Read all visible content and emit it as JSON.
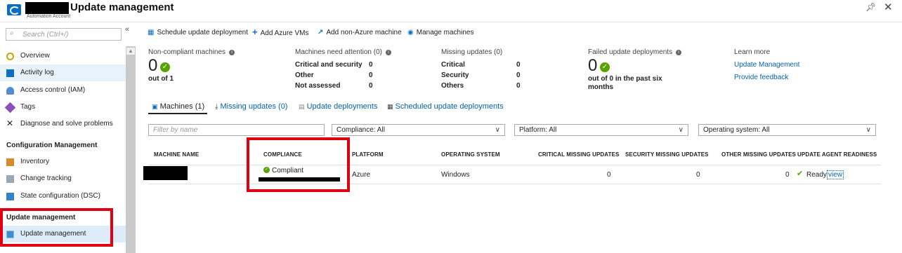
{
  "header": {
    "title": "Update management",
    "subtitle": "Automation Account"
  },
  "sidebar": {
    "search_placeholder": "Search (Ctrl+/)",
    "items_top": [
      {
        "label": "Overview",
        "icon": "overview-icon"
      },
      {
        "label": "Activity log",
        "icon": "activity-log-icon"
      },
      {
        "label": "Access control (IAM)",
        "icon": "access-control-icon"
      },
      {
        "label": "Tags",
        "icon": "tag-icon"
      },
      {
        "label": "Diagnose and solve problems",
        "icon": "wrench-icon"
      }
    ],
    "section_config": "Configuration Management",
    "items_config": [
      {
        "label": "Inventory",
        "icon": "inventory-icon"
      },
      {
        "label": "Change tracking",
        "icon": "change-tracking-icon"
      },
      {
        "label": "State configuration (DSC)",
        "icon": "dsc-icon"
      }
    ],
    "section_update": "Update management",
    "items_update": [
      {
        "label": "Update management",
        "icon": "update-management-icon"
      }
    ]
  },
  "toolbar": {
    "schedule": "Schedule update deployment",
    "add_azure": "Add Azure VMs",
    "add_non_azure": "Add non-Azure machine",
    "manage": "Manage machines"
  },
  "summary": {
    "noncompliant": {
      "label": "Non-compliant machines",
      "value": "0",
      "caption": "out of 1"
    },
    "attention": {
      "label": "Machines need attention (0)",
      "rows": [
        {
          "key": "Critical and security",
          "value": "0"
        },
        {
          "key": "Other",
          "value": "0"
        },
        {
          "key": "Not assessed",
          "value": "0"
        }
      ]
    },
    "missing": {
      "label": "Missing updates (0)",
      "rows": [
        {
          "key": "Critical",
          "value": "0"
        },
        {
          "key": "Security",
          "value": "0"
        },
        {
          "key": "Others",
          "value": "0"
        }
      ]
    },
    "failed": {
      "label": "Failed update deployments",
      "value": "0",
      "caption_line1": "out of 0 in the past six",
      "caption_line2": "months"
    },
    "learn": {
      "label": "Learn more",
      "link1": "Update Management",
      "link2": "Provide feedback"
    }
  },
  "tabs": [
    {
      "label": "Machines (1)",
      "icon": "monitor-icon"
    },
    {
      "label": "Missing updates (0)",
      "icon": "download-icon"
    },
    {
      "label": "Update deployments",
      "icon": "deployments-icon"
    },
    {
      "label": "Scheduled update deployments",
      "icon": "calendar-icon"
    }
  ],
  "filters": {
    "name_placeholder": "Filter by name",
    "compliance": "Compliance: All",
    "platform": "Platform: All",
    "os": "Operating system: All"
  },
  "table": {
    "headers": [
      "MACHINE NAME",
      "COMPLIANCE",
      "PLATFORM",
      "OPERATING SYSTEM",
      "CRITICAL MISSING UPDATES",
      "SECURITY MISSING UPDATES",
      "OTHER MISSING UPDATES",
      "UPDATE AGENT READINESS"
    ],
    "row": {
      "compliance": "Compliant",
      "platform": "Azure",
      "os": "Windows",
      "critical": "0",
      "security": "0",
      "other": "0",
      "readiness": "Ready",
      "view": "view"
    }
  },
  "colors": {
    "accent": "#0063b1",
    "highlight_box": "#e00012",
    "ok_green": "#57a300"
  }
}
